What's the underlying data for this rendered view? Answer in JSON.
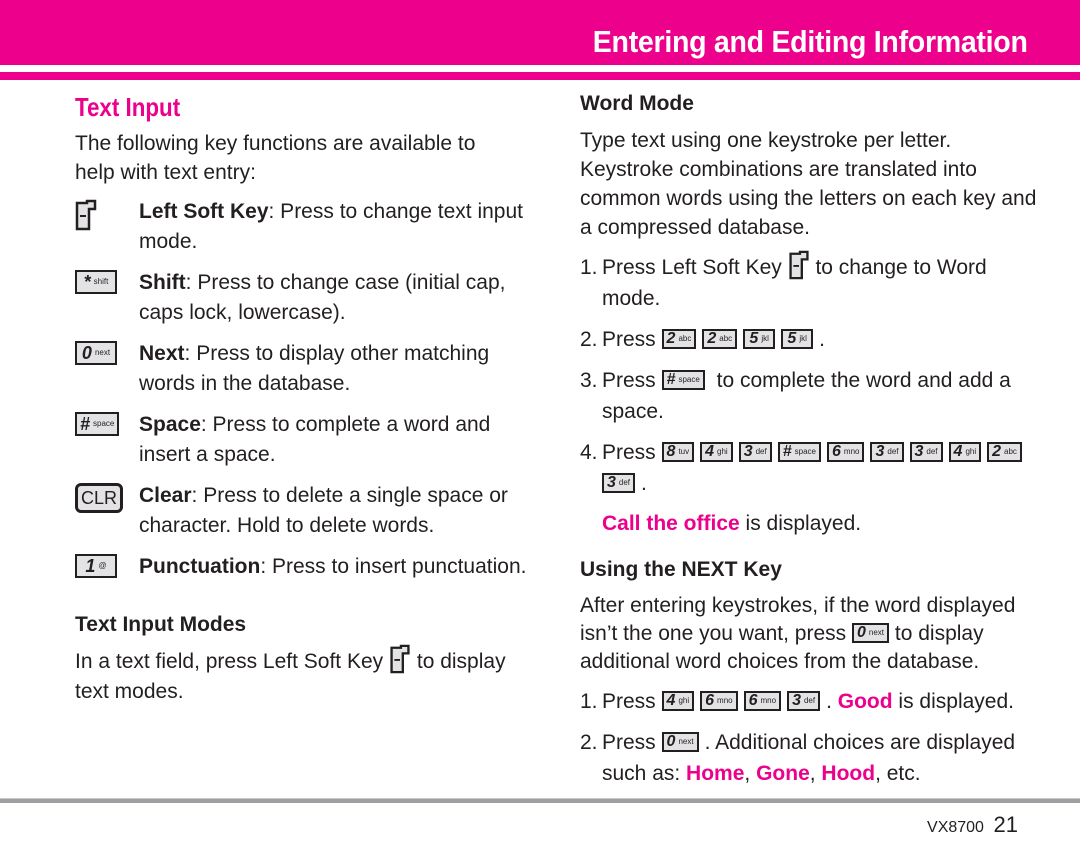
{
  "header": {
    "title": "Entering and Editing Information"
  },
  "left": {
    "section_title": "Text Input",
    "intro": "The following key functions are available to help with text entry:",
    "keys": [
      {
        "icon": "left-soft-key-icon",
        "label": "Left Soft Key",
        "desc": ": Press to change text input mode."
      },
      {
        "icon": "shift-key-icon",
        "key_main": "*",
        "key_sub": "shift",
        "label": "Shift",
        "desc": ": Press to change case (initial cap, caps lock, lowercase)."
      },
      {
        "icon": "next-key-icon",
        "key_main": "0",
        "key_sub": "next",
        "label": "Next",
        "desc": ": Press to display other matching words in the database."
      },
      {
        "icon": "space-key-icon",
        "key_main": "#",
        "key_sub": "space",
        "label": "Space",
        "desc": ": Press to complete a word and insert a space."
      },
      {
        "icon": "clear-key-icon",
        "key_main": "CLR",
        "label": "Clear",
        "desc": ": Press to delete a single space or character. Hold to delete words."
      },
      {
        "icon": "punctuation-key-icon",
        "key_main": "1",
        "key_sub": "@",
        "label": "Punctuation",
        "desc": ": Press to insert punctuation."
      }
    ],
    "modes_title": "Text Input Modes",
    "modes_text_before": "In a text field, press Left Soft Key",
    "modes_text_after": "to display text modes."
  },
  "right": {
    "word_mode_title": "Word Mode",
    "word_mode_text": "Type text using one keystroke per letter. Keystroke combinations are translated into common words using the letters on each key and a compressed database.",
    "steps": [
      {
        "n": "1.",
        "before": "Press Left Soft Key",
        "after": "to change to Word mode."
      },
      {
        "n": "2.",
        "before": "Press",
        "keys": [
          [
            "2",
            "abc"
          ],
          [
            "2",
            "abc"
          ],
          [
            "5",
            "jkl"
          ],
          [
            "5",
            "jkl"
          ]
        ],
        "after": "."
      },
      {
        "n": "3.",
        "before": "Press",
        "keys": [
          [
            "#",
            "space"
          ]
        ],
        "after": "to complete the word and add a space."
      },
      {
        "n": "4.",
        "before": "Press",
        "keys": [
          [
            "8",
            "tuv"
          ],
          [
            "4",
            "ghi"
          ],
          [
            "3",
            "def"
          ],
          [
            "#",
            "space"
          ],
          [
            "6",
            "mno"
          ],
          [
            "3",
            "def"
          ],
          [
            "3",
            "def"
          ],
          [
            "4",
            "ghi"
          ],
          [
            "2",
            "abc"
          ],
          [
            "3",
            "def"
          ]
        ],
        "after": "."
      }
    ],
    "result_highlight": "Call the office",
    "result_text": " is displayed.",
    "next_title": "Using the NEXT Key",
    "next_text_before": "After entering keystrokes, if the word displayed isn’t the one you want, press",
    "next_text_after": "to display additional word choices from the database.",
    "next_key": [
      "0",
      "next"
    ],
    "next_steps": [
      {
        "n": "1.",
        "before": "Press",
        "keys": [
          [
            "4",
            "ghi"
          ],
          [
            "6",
            "mno"
          ],
          [
            "6",
            "mno"
          ],
          [
            "3",
            "def"
          ]
        ],
        "after": ". ",
        "highlight": "Good",
        "tail": " is displayed."
      },
      {
        "n": "2.",
        "before": "Press",
        "keys": [
          [
            "0",
            "next"
          ]
        ],
        "after": ". Additional choices are displayed such as: ",
        "words": [
          "Home",
          "Gone",
          "Hood"
        ],
        "tail": ", etc."
      }
    ]
  },
  "footer": {
    "model": "VX8700",
    "page": "21"
  },
  "colors": {
    "accent": "#ec008c",
    "text": "#231f20",
    "key_fill": "#e3e3e6",
    "rule": "#9e9fa3"
  }
}
